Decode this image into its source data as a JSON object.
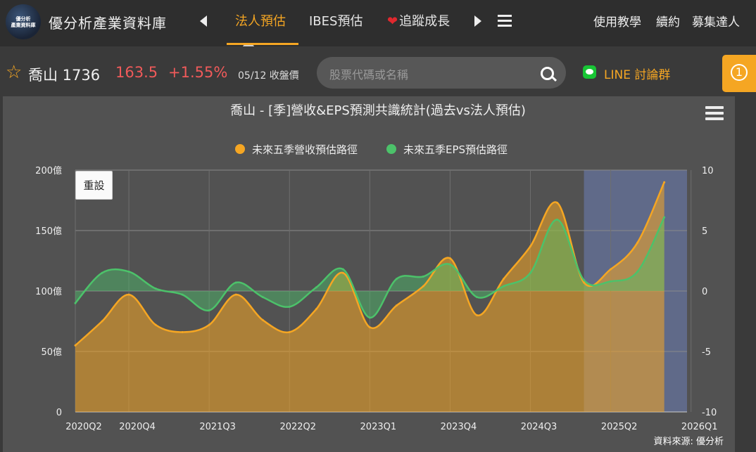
{
  "header": {
    "logo_text": [
      "優分析",
      "產業資料庫"
    ],
    "site_title": "優分析產業資料庫",
    "nav": [
      "法人預估",
      "IBES預估",
      "追蹤成長"
    ],
    "right_links": [
      "使用教學",
      "續約",
      "募集達人"
    ]
  },
  "stock": {
    "name": "喬山 1736",
    "price": "163.5",
    "change": "+1.55%",
    "date": "05/12 收盤價"
  },
  "search": {
    "placeholder": "股票代碼或名稱"
  },
  "line_group": "LINE 討論群",
  "badge": "1",
  "colors": {
    "revenue": "#f5a623",
    "eps": "#4cc26a",
    "forecast_band": "#6878a8",
    "up": "#f05a5a"
  },
  "chart_data": {
    "type": "area",
    "title": "喬山 - [季]營收&EPS預測共識統計(過去vs法人預估)",
    "reset_label": "重設",
    "source": "資料來源: 優分析",
    "x_tick_labels": [
      "2020Q2",
      "2020Q4",
      "2021Q3",
      "2022Q2",
      "2023Q1",
      "2023Q4",
      "2024Q3",
      "2025Q2",
      "2026Q1"
    ],
    "x_tick_index": [
      0,
      2,
      5,
      8,
      11,
      14,
      17,
      20,
      23
    ],
    "categories": [
      "2020Q2",
      "2020Q3",
      "2020Q4",
      "2021Q1",
      "2021Q2",
      "2021Q3",
      "2021Q4",
      "2022Q1",
      "2022Q2",
      "2022Q3",
      "2022Q4",
      "2023Q1",
      "2023Q2",
      "2023Q3",
      "2023Q4",
      "2024Q1",
      "2024Q2",
      "2024Q3",
      "2024Q4",
      "2025Q1",
      "2025Q2",
      "2025Q3",
      "2025Q4"
    ],
    "forecast_start_index": 19,
    "forecast_end_index": 23.4,
    "y_left": {
      "ticks": [
        "0",
        "50億",
        "100億",
        "150億",
        "200億"
      ],
      "min": 0,
      "max": 200
    },
    "y_right": {
      "ticks": [
        "-10",
        "-5",
        "0",
        "5",
        "10"
      ],
      "min": -10,
      "max": 10
    },
    "series": [
      {
        "name": "未來五季營收預估路徑",
        "axis": "left",
        "values": [
          55,
          75,
          97,
          72,
          66,
          72,
          97,
          76,
          66,
          85,
          115,
          70,
          88,
          104,
          127,
          80,
          110,
          137,
          173,
          107,
          118,
          140,
          190
        ]
      },
      {
        "name": "未來五季EPS預估路徑",
        "axis": "right",
        "values": [
          -1.0,
          1.5,
          1.6,
          0.2,
          -0.3,
          -1.6,
          0.7,
          -0.5,
          -1.3,
          0.3,
          1.8,
          -2.2,
          1.0,
          1.2,
          2.2,
          -0.5,
          0.4,
          1.5,
          5.9,
          0.9,
          0.8,
          1.6,
          6.1
        ]
      }
    ],
    "grid": true,
    "legend": "top-center"
  }
}
